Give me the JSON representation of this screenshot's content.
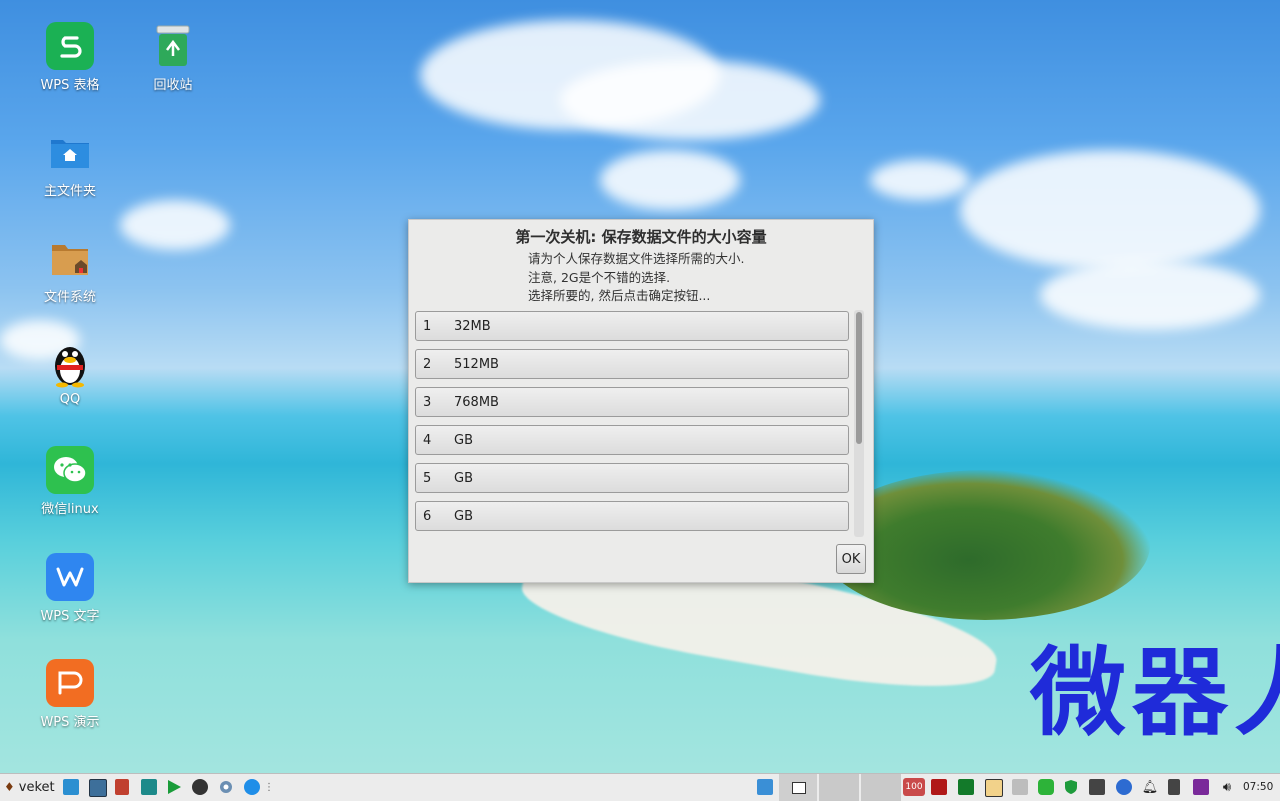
{
  "desktop": {
    "icons": [
      {
        "label": "WPS 表格",
        "icon": "wps-spreadsheet-icon",
        "color": "#1bb154"
      },
      {
        "label": "回收站",
        "icon": "recycle-bin-icon",
        "color": "#2e9e50"
      },
      {
        "label": "主文件夹",
        "icon": "home-folder-icon",
        "color": "#2a7fd4"
      },
      {
        "label": "文件系统",
        "icon": "file-system-icon",
        "color": "#c98a3a"
      },
      {
        "label": "QQ",
        "icon": "qq-penguin-icon",
        "color": "#111111"
      },
      {
        "label": "微信linux",
        "icon": "wechat-icon",
        "color": "#2ec14f"
      },
      {
        "label": "WPS 文字",
        "icon": "wps-writer-icon",
        "color": "#2f86f0"
      },
      {
        "label": "WPS 演示",
        "icon": "wps-presentation-icon",
        "color": "#f26d22"
      }
    ],
    "wallpaper_text": "微器人",
    "wallpaper_text_color": "#1f2bd9"
  },
  "dialog": {
    "title": "第一次关机: 保存数据文件的大小容量",
    "info_lines": [
      "请为个人保存数据文件选择所需的大小.",
      "注意, 2G是个不错的选择.",
      "选择所要的, 然后点击确定按钮..."
    ],
    "options": [
      {
        "num": "1",
        "value": "32MB"
      },
      {
        "num": "2",
        "value": "512MB"
      },
      {
        "num": "3",
        "value": "768MB"
      },
      {
        "num": "4",
        "value": "GB"
      },
      {
        "num": "5",
        "value": "GB"
      },
      {
        "num": "6",
        "value": "GB"
      }
    ],
    "ok_label": "OK"
  },
  "taskbar": {
    "start_label": "veket",
    "clock": "07:50",
    "battery_badge": "100"
  }
}
